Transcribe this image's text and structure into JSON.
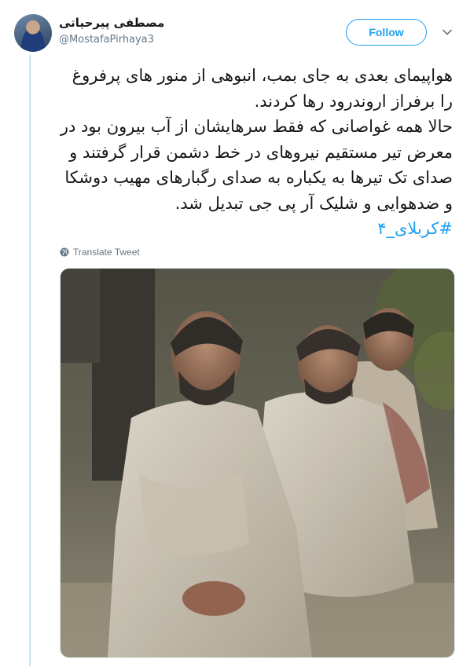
{
  "author": {
    "display_name": "مصطفی پیرحیاتی",
    "handle": "@MostafaPirhaya3"
  },
  "actions": {
    "follow_label": "Follow"
  },
  "tweet": {
    "paragraph_1": "هواپیمای بعدی به جای بمب، انبوهی از منور های پرفروغ را برفراز اروندرود رها کردند.",
    "paragraph_2": "حالا همه غواصانی که فقط سرهایشان از آب بیرون بود در معرض تیر مستقیم نیروهای در خط دشمن قرار گرفتند و صدای تک تیرها به یکباره به صدای رگبارهای مهیب دوشکا و ضدهوایی و شلیک آر پی جی تبدیل شد.",
    "hashtag": "#کربلای_۴",
    "translate_label": "Translate Tweet"
  },
  "icons": {
    "more": "chevron-down-icon",
    "translate": "globe-icon"
  },
  "colors": {
    "accent": "#1da1f2",
    "secondary_text": "#657786",
    "thread_line": "#cbe4f3"
  }
}
